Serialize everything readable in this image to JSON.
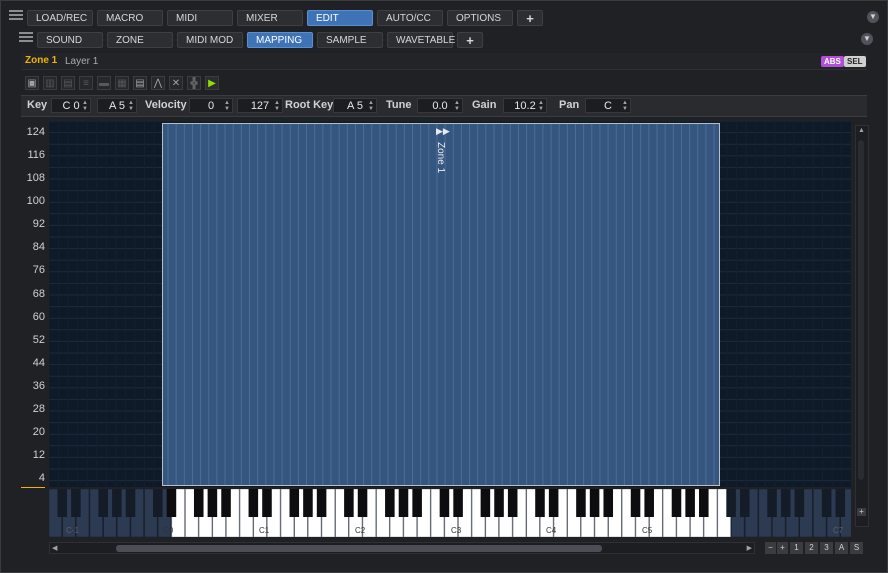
{
  "top_tabs": [
    {
      "label": "LOAD/REC",
      "active": false
    },
    {
      "label": "MACRO",
      "active": false
    },
    {
      "label": "MIDI",
      "active": false
    },
    {
      "label": "MIXER",
      "active": false
    },
    {
      "label": "EDIT",
      "active": true
    },
    {
      "label": "AUTO/CC",
      "active": false
    },
    {
      "label": "OPTIONS",
      "active": false
    }
  ],
  "edit_tabs": [
    {
      "label": "SOUND",
      "active": false
    },
    {
      "label": "ZONE",
      "active": false
    },
    {
      "label": "MIDI MOD",
      "active": false
    },
    {
      "label": "MAPPING",
      "active": true
    },
    {
      "label": "SAMPLE",
      "active": false
    },
    {
      "label": "WAVETABLE",
      "active": false
    }
  ],
  "plus_label": "+",
  "zone_bar": {
    "zone": "Zone 1",
    "layer": "Layer 1",
    "abs_label": "ABS",
    "sel_label": "SEL"
  },
  "params": {
    "key_label": "Key",
    "key_low": "C 0",
    "key_high": "A 5",
    "velocity_label": "Velocity",
    "vel_low": "0",
    "vel_high": "127",
    "rootkey_label": "Root Key",
    "rootkey": "A 5",
    "tune_label": "Tune",
    "tune": "0.0",
    "gain_label": "Gain",
    "gain": "10.2",
    "pan_label": "Pan",
    "pan": "C"
  },
  "velocity_ticks": [
    "124",
    "116",
    "108",
    "100",
    "92",
    "84",
    "76",
    "68",
    "60",
    "52",
    "44",
    "36",
    "28",
    "20",
    "12",
    "4"
  ],
  "zone_label": "Zone 1",
  "keyboard_octaves": [
    "C-1",
    "C0",
    "C1",
    "C2",
    "C3",
    "C4",
    "C5",
    "C7"
  ],
  "scroll_buttons": [
    "1",
    "2",
    "3",
    "A",
    "S"
  ],
  "colors": {
    "accent": "#3e73b8",
    "zone_fill": "#35567f",
    "zone_name": "#f0b400",
    "abs_badge": "#b050d8",
    "sel_badge": "#d0d0d0"
  }
}
